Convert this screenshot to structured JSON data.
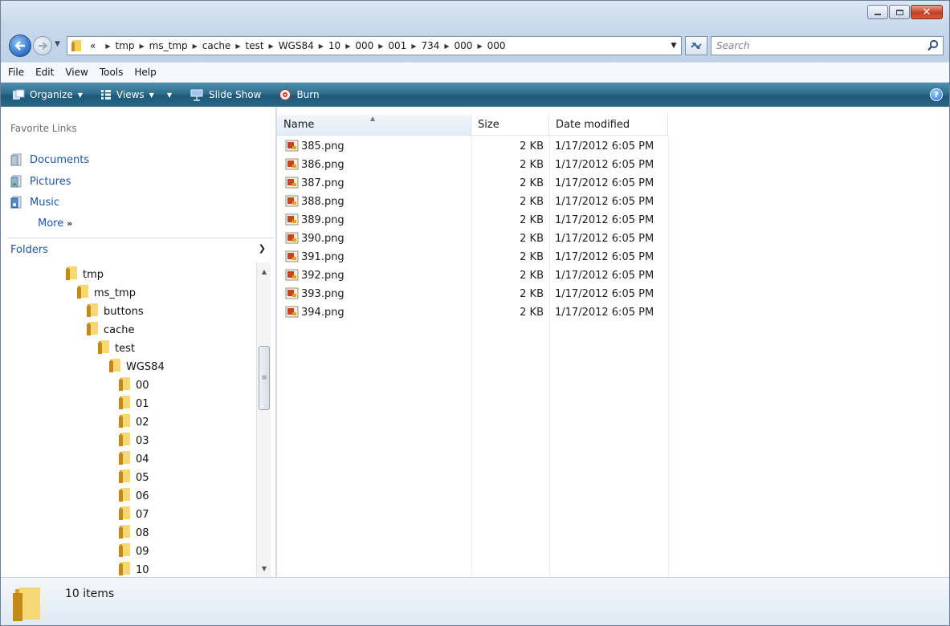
{
  "window": {
    "caption_buttons": [
      "minimize",
      "maximize",
      "close"
    ]
  },
  "address": {
    "overflow": "«",
    "crumbs": [
      "tmp",
      "ms_tmp",
      "cache",
      "test",
      "WGS84",
      "10",
      "000",
      "001",
      "734",
      "000",
      "000"
    ]
  },
  "search": {
    "placeholder": "Search"
  },
  "menu": [
    "File",
    "Edit",
    "View",
    "Tools",
    "Help"
  ],
  "toolbar": {
    "organize": "Organize",
    "views": "Views",
    "slideshow": "Slide Show",
    "burn": "Burn",
    "help": "?"
  },
  "favorites": {
    "title": "Favorite Links",
    "items": [
      "Documents",
      "Pictures",
      "Music"
    ],
    "more": "More",
    "more_glyph": "»"
  },
  "folders": {
    "title": "Folders",
    "tree": [
      {
        "label": "tmp",
        "level": 0
      },
      {
        "label": "ms_tmp",
        "level": 1
      },
      {
        "label": "buttons",
        "level": 2
      },
      {
        "label": "cache",
        "level": 2
      },
      {
        "label": "test",
        "level": 3
      },
      {
        "label": "WGS84",
        "level": 4
      },
      {
        "label": "00",
        "level": 5
      },
      {
        "label": "01",
        "level": 5
      },
      {
        "label": "02",
        "level": 5
      },
      {
        "label": "03",
        "level": 5
      },
      {
        "label": "04",
        "level": 5
      },
      {
        "label": "05",
        "level": 5
      },
      {
        "label": "06",
        "level": 5
      },
      {
        "label": "07",
        "level": 5
      },
      {
        "label": "08",
        "level": 5
      },
      {
        "label": "09",
        "level": 5
      },
      {
        "label": "10",
        "level": 5
      }
    ]
  },
  "files": {
    "columns": {
      "name": "Name",
      "size": "Size",
      "date": "Date modified"
    },
    "rows": [
      {
        "name": "385.png",
        "size": "2 KB",
        "date": "1/17/2012 6:05 PM"
      },
      {
        "name": "386.png",
        "size": "2 KB",
        "date": "1/17/2012 6:05 PM"
      },
      {
        "name": "387.png",
        "size": "2 KB",
        "date": "1/17/2012 6:05 PM"
      },
      {
        "name": "388.png",
        "size": "2 KB",
        "date": "1/17/2012 6:05 PM"
      },
      {
        "name": "389.png",
        "size": "2 KB",
        "date": "1/17/2012 6:05 PM"
      },
      {
        "name": "390.png",
        "size": "2 KB",
        "date": "1/17/2012 6:05 PM"
      },
      {
        "name": "391.png",
        "size": "2 KB",
        "date": "1/17/2012 6:05 PM"
      },
      {
        "name": "392.png",
        "size": "2 KB",
        "date": "1/17/2012 6:05 PM"
      },
      {
        "name": "393.png",
        "size": "2 KB",
        "date": "1/17/2012 6:05 PM"
      },
      {
        "name": "394.png",
        "size": "2 KB",
        "date": "1/17/2012 6:05 PM"
      }
    ]
  },
  "status": {
    "count": "10 items"
  }
}
